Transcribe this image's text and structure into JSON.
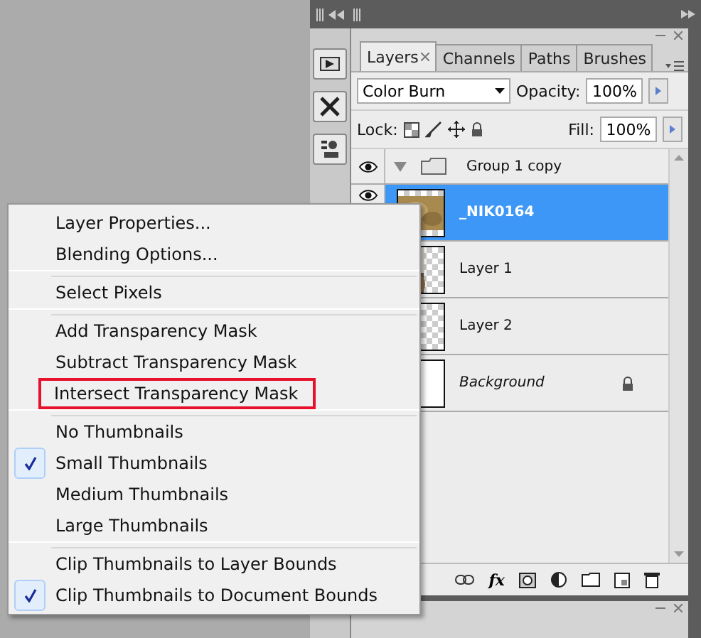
{
  "panel": {
    "tabs": [
      {
        "label": "Layers",
        "selected": true,
        "closable": true
      },
      {
        "label": "Channels",
        "selected": false,
        "closable": false
      },
      {
        "label": "Paths",
        "selected": false,
        "closable": false
      },
      {
        "label": "Brushes",
        "selected": false,
        "closable": false
      }
    ],
    "blend_mode": "Color Burn",
    "opacity_label": "Opacity:",
    "opacity": "100%",
    "lock_label": "Lock:",
    "fill_label": "Fill:",
    "fill": "100%",
    "layers": [
      {
        "kind": "group",
        "name": "Group 1 copy",
        "visible": true,
        "selected": false,
        "expanded": true
      },
      {
        "kind": "texture",
        "name": "_NIK0164",
        "visible": true,
        "selected": true
      },
      {
        "name": "Layer 1",
        "selected": false
      },
      {
        "kind": "empty",
        "name": "Layer 2",
        "selected": false
      },
      {
        "kind": "white",
        "name": "Background",
        "selected": false,
        "locked": true
      }
    ],
    "styles_button": "fx"
  },
  "context_menu": [
    [
      {
        "label": "Layer Properties...",
        "checked": false,
        "outlined": false
      },
      {
        "label": "Blending Options...",
        "checked": false,
        "outlined": false
      }
    ],
    [
      {
        "label": "Select Pixels",
        "checked": false,
        "outlined": false
      }
    ],
    [
      {
        "label": "Add Transparency Mask",
        "checked": false,
        "outlined": false
      },
      {
        "label": "Subtract Transparency Mask",
        "checked": false,
        "outlined": false
      },
      {
        "label": "Intersect Transparency Mask",
        "checked": false,
        "outlined": true
      }
    ],
    [
      {
        "label": "No Thumbnails",
        "checked": false,
        "outlined": false
      },
      {
        "label": "Small Thumbnails",
        "checked": true,
        "outlined": false
      },
      {
        "label": "Medium Thumbnails",
        "checked": false,
        "outlined": false
      },
      {
        "label": "Large Thumbnails",
        "checked": false,
        "outlined": false
      }
    ],
    [
      {
        "label": "Clip Thumbnails to Layer Bounds",
        "checked": false,
        "outlined": false
      },
      {
        "label": "Clip Thumbnails to Document Bounds",
        "checked": true,
        "outlined": false
      }
    ]
  ]
}
